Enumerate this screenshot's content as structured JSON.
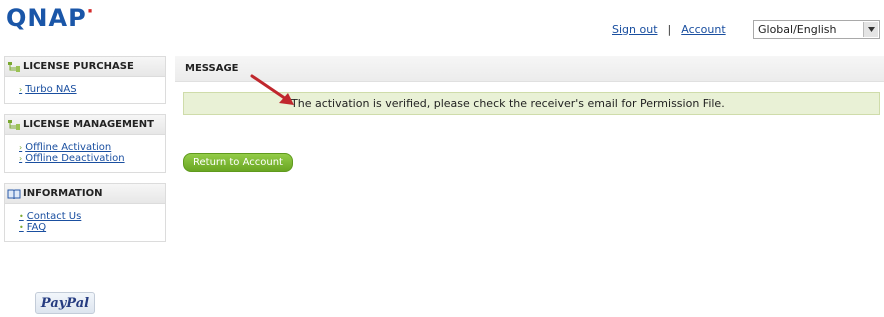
{
  "header": {
    "logo_text": "QNAP",
    "signout_label": "Sign out",
    "separator": "|",
    "account_label": "Account",
    "language": {
      "selected": "Global/English"
    }
  },
  "sidebar": {
    "panels": [
      {
        "title": "LICENSE PURCHASE",
        "icon": "tree-icon",
        "links": [
          "Turbo NAS"
        ]
      },
      {
        "title": "LICENSE MANAGEMENT",
        "icon": "tree-icon",
        "links": [
          "Offline Activation",
          "Offline Deactivation"
        ]
      },
      {
        "title": "INFORMATION",
        "icon": "book-icon",
        "links": [
          "Contact Us",
          "FAQ"
        ]
      }
    ],
    "paypal_text": "PayPal"
  },
  "main": {
    "heading": "MESSAGE",
    "message": "The activation is verified, please check the receiver's email for Permission File.",
    "button_label": "Return to Account"
  },
  "colors": {
    "brand_blue": "#1a56a8",
    "message_bg": "#e9f1d6",
    "button_green": "#7cb834",
    "arrow_red": "#c0272d",
    "link_blue": "#1a4fa0"
  }
}
